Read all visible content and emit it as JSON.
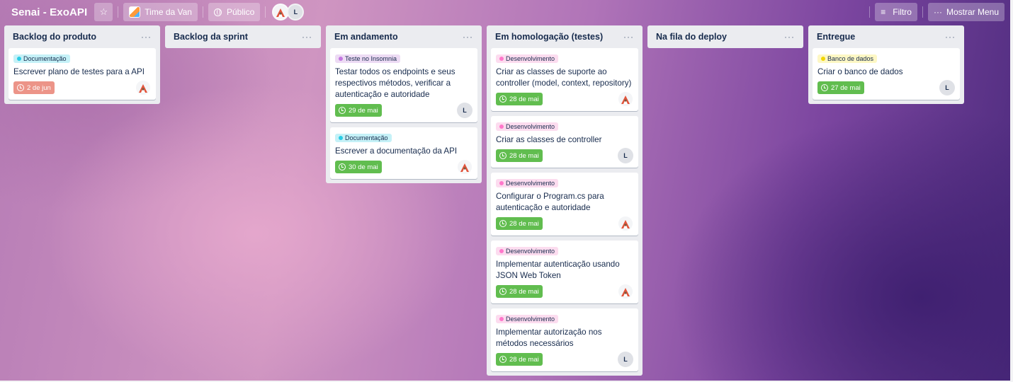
{
  "header": {
    "board_title": "Senai - ExoAPI",
    "star_glyph": "☆",
    "team": "Time da Van",
    "visibility": "Público",
    "member_initial": "L",
    "filter": "Filtro",
    "filter_glyph": "≡",
    "menu": "Mostrar Menu",
    "menu_glyph": "···"
  },
  "lists": [
    {
      "title": "Backlog do produto",
      "menu": "···",
      "cards": [
        {
          "label": "Documentação",
          "label_color": "#29cce5",
          "label_bg": "#c5f1f7",
          "title": "Escrever plano de testes para a API",
          "due": "2 de jun",
          "due_status": "overdue",
          "member": "avatar-image"
        }
      ]
    },
    {
      "title": "Backlog da sprint",
      "menu": "···",
      "cards": []
    },
    {
      "title": "Em andamento",
      "menu": "···",
      "cards": [
        {
          "label": "Teste no Insomnia",
          "label_color": "#c377e0",
          "label_bg": "#eddbf4",
          "title": "Testar todos os endpoints e seus respectivos métodos, verificar a autenticação e autoridade",
          "due": "29 de mai",
          "due_status": "complete",
          "member": "L"
        },
        {
          "label": "Documentação",
          "label_color": "#29cce5",
          "label_bg": "#c5f1f7",
          "title": "Escrever a documentação da API",
          "due": "30 de mai",
          "due_status": "complete",
          "member": "avatar-image"
        }
      ]
    },
    {
      "title": "Em homologação (testes)",
      "menu": "···",
      "cards": [
        {
          "label": "Desenvolvimento",
          "label_color": "#ff78cb",
          "label_bg": "#fcdcef",
          "title": "Criar as classes de suporte ao controller (model, context, repository)",
          "due": "28 de mai",
          "due_status": "complete",
          "member": "avatar-image"
        },
        {
          "label": "Desenvolvimento",
          "label_color": "#ff78cb",
          "label_bg": "#fcdcef",
          "title": "Criar as classes de controller",
          "due": "28 de mai",
          "due_status": "complete",
          "member": "L"
        },
        {
          "label": "Desenvolvimento",
          "label_color": "#ff78cb",
          "label_bg": "#fcdcef",
          "title": "Configurar o Program.cs para autenticação e autoridade",
          "due": "28 de mai",
          "due_status": "complete",
          "member": "avatar-image"
        },
        {
          "label": "Desenvolvimento",
          "label_color": "#ff78cb",
          "label_bg": "#fcdcef",
          "title": "Implementar autenticação usando JSON Web Token",
          "due": "28 de mai",
          "due_status": "complete",
          "member": "avatar-image"
        },
        {
          "label": "Desenvolvimento",
          "label_color": "#ff78cb",
          "label_bg": "#fcdcef",
          "title": "Implementar autorização nos métodos necessários",
          "due": "28 de mai",
          "due_status": "complete",
          "member": "L"
        }
      ]
    },
    {
      "title": "Na fila do deploy",
      "menu": "···",
      "cards": []
    },
    {
      "title": "Entregue",
      "menu": "···",
      "cards": [
        {
          "label": "Banco de dados",
          "label_color": "#f2d600",
          "label_bg": "#fdf7c4",
          "title": "Criar o banco de dados",
          "due": "27 de mai",
          "due_status": "complete",
          "member": "L"
        }
      ]
    }
  ]
}
